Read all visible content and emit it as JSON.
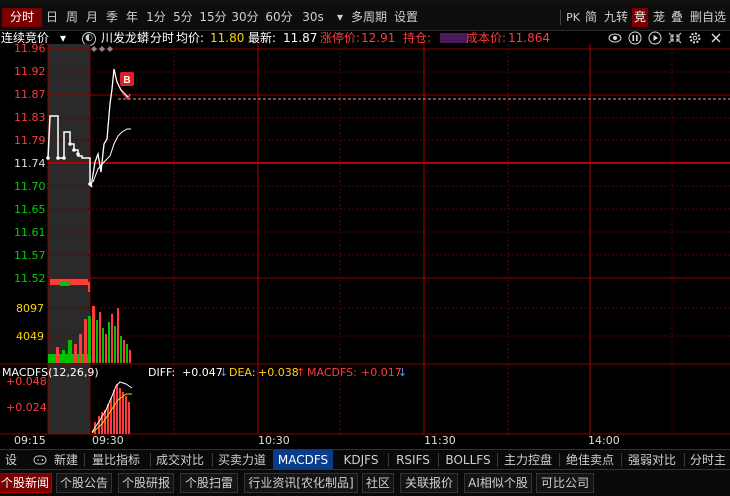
{
  "toolbar": {
    "items": [
      "分时",
      "日",
      "周",
      "月",
      "季",
      "年",
      "1分",
      "5分",
      "15分",
      "30分",
      "60分",
      "30s",
      "多周期",
      "设置"
    ],
    "active_index": 0,
    "period_dropdown": "▾",
    "right_items": [
      "PK",
      "简",
      "九转",
      "竞",
      "茏",
      "叠",
      "删自选"
    ]
  },
  "info": {
    "auction_label": "连续竞价",
    "stock_name": "川发龙蟒",
    "mode": "分时",
    "avg_label": "均价:",
    "avg_value": "11.80",
    "latest_label": "最新:",
    "latest_value": "11.87",
    "limit_up_label": "涨停价:",
    "limit_up_value": "12.91",
    "position_label": "持仓:",
    "cost_label": "成本价:",
    "cost_value": "11.864"
  },
  "price_axis": [
    "11.96",
    "11.92",
    "11.87",
    "11.83",
    "11.79",
    "11.74",
    "11.70",
    "11.65",
    "11.61",
    "11.57",
    "11.52"
  ],
  "volume_axis": [
    "8097",
    "4049"
  ],
  "macd": {
    "label": "MACDFS(12,26,9)",
    "diff_label": "DIFF: ",
    "diff_value": "+0.047",
    "dea_label": "DEA: ",
    "dea_value": "+0.038",
    "macdfs_label": "MACDFS: ",
    "macdfs_value": "+0.017",
    "axis": [
      "+0.048",
      "+0.024"
    ]
  },
  "time_axis": [
    "09:15",
    "09:30",
    "10:30",
    "11:30",
    "14:00"
  ],
  "buy_marker": "B",
  "bottom_tabs": [
    "设置",
    "新建",
    "量比指标",
    "成交对比",
    "买卖力道",
    "MACDFS",
    "KDJFS",
    "RSIFS",
    "BOLLFS",
    "主力控盘",
    "绝佳卖点",
    "强弱对比",
    "分时主"
  ],
  "active_tab": "MACDFS",
  "news_tabs": [
    "个股新闻",
    "个股公告",
    "个股研报",
    "个股扫雷",
    "行业资讯[农化制品]",
    "社区",
    "关联报价",
    "AI相似个股",
    "可比公司"
  ],
  "active_news": "个股新闻",
  "colors": {
    "up": "#ff3b3b",
    "down": "#00d000",
    "grid": "#8a0000",
    "accent": "#ffd400"
  }
}
